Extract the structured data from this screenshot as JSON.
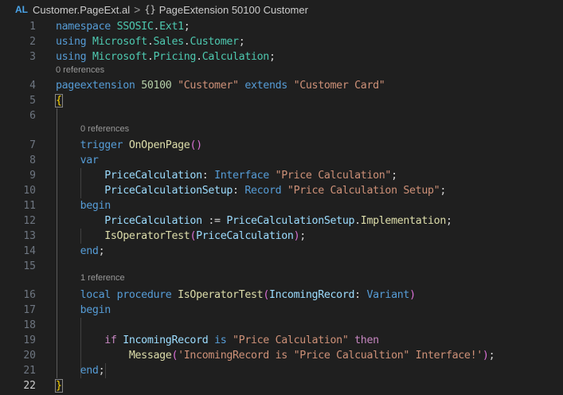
{
  "breadcrumb": {
    "lang_badge": "AL",
    "file_name": "Customer.PageExt.al",
    "separator": ">",
    "symbol_icon": "{}",
    "symbol_name": "PageExtension 50100 Customer"
  },
  "icons": {
    "lang_badge": "al-file-icon",
    "separator": "chevron-right-icon",
    "symbol": "braces-icon"
  },
  "code_lens": {
    "pageextension": "0 references",
    "trigger": "0 references",
    "procedure": "1 reference"
  },
  "lines": [
    {
      "n": "1",
      "t": [
        [
          "kw",
          "namespace"
        ],
        [
          "pl",
          " "
        ],
        [
          "ty",
          "SSOSIC"
        ],
        [
          "pl",
          "."
        ],
        [
          "ty",
          "Ext1"
        ],
        [
          "pl",
          ";"
        ]
      ]
    },
    {
      "n": "2",
      "t": [
        [
          "kw",
          "using"
        ],
        [
          "pl",
          " "
        ],
        [
          "ty",
          "Microsoft"
        ],
        [
          "pl",
          "."
        ],
        [
          "ty",
          "Sales"
        ],
        [
          "pl",
          "."
        ],
        [
          "ty",
          "Customer"
        ],
        [
          "pl",
          ";"
        ]
      ]
    },
    {
      "n": "3",
      "t": [
        [
          "kw",
          "using"
        ],
        [
          "pl",
          " "
        ],
        [
          "ty",
          "Microsoft"
        ],
        [
          "pl",
          "."
        ],
        [
          "ty",
          "Pricing"
        ],
        [
          "pl",
          "."
        ],
        [
          "ty",
          "Calculation"
        ],
        [
          "pl",
          ";"
        ]
      ]
    },
    {
      "n": "4",
      "t": [
        [
          "kw",
          "pageextension"
        ],
        [
          "pl",
          " "
        ],
        [
          "num",
          "50100"
        ],
        [
          "pl",
          " "
        ],
        [
          "str",
          "\"Customer\""
        ],
        [
          "pl",
          " "
        ],
        [
          "kw",
          "extends"
        ],
        [
          "pl",
          " "
        ],
        [
          "str",
          "\"Customer Card\""
        ]
      ]
    },
    {
      "n": "5",
      "t": [
        [
          "brkbox",
          "{"
        ]
      ]
    },
    {
      "n": "6",
      "t": []
    },
    {
      "n": "7",
      "t": [
        [
          "pl",
          "    "
        ],
        [
          "kw",
          "trigger"
        ],
        [
          "pl",
          " "
        ],
        [
          "fn",
          "OnOpenPage"
        ],
        [
          "brk2",
          "()"
        ]
      ]
    },
    {
      "n": "8",
      "t": [
        [
          "pl",
          "    "
        ],
        [
          "kw",
          "var"
        ]
      ]
    },
    {
      "n": "9",
      "t": [
        [
          "pl",
          "        "
        ],
        [
          "var",
          "PriceCalculation"
        ],
        [
          "pl",
          ": "
        ],
        [
          "kw",
          "Interface"
        ],
        [
          "pl",
          " "
        ],
        [
          "str",
          "\"Price Calculation\""
        ],
        [
          "pl",
          ";"
        ]
      ]
    },
    {
      "n": "10",
      "t": [
        [
          "pl",
          "        "
        ],
        [
          "var",
          "PriceCalculationSetup"
        ],
        [
          "pl",
          ": "
        ],
        [
          "kw",
          "Record"
        ],
        [
          "pl",
          " "
        ],
        [
          "str",
          "\"Price Calculation Setup\""
        ],
        [
          "pl",
          ";"
        ]
      ]
    },
    {
      "n": "11",
      "t": [
        [
          "pl",
          "    "
        ],
        [
          "kw",
          "begin"
        ]
      ]
    },
    {
      "n": "12",
      "t": [
        [
          "pl",
          "        "
        ],
        [
          "var",
          "PriceCalculation"
        ],
        [
          "pl",
          " := "
        ],
        [
          "var",
          "PriceCalculationSetup"
        ],
        [
          "pl",
          "."
        ],
        [
          "fn",
          "Implementation"
        ],
        [
          "pl",
          ";"
        ]
      ]
    },
    {
      "n": "13",
      "t": [
        [
          "pl",
          "        "
        ],
        [
          "fn",
          "IsOperatorTest"
        ],
        [
          "brk2",
          "("
        ],
        [
          "var",
          "PriceCalculation"
        ],
        [
          "brk2",
          ")"
        ],
        [
          "pl",
          ";"
        ]
      ]
    },
    {
      "n": "14",
      "t": [
        [
          "pl",
          "    "
        ],
        [
          "kw",
          "end"
        ],
        [
          "pl",
          ";"
        ]
      ]
    },
    {
      "n": "15",
      "t": []
    },
    {
      "n": "16",
      "t": [
        [
          "pl",
          "    "
        ],
        [
          "kw",
          "local"
        ],
        [
          "pl",
          " "
        ],
        [
          "kw",
          "procedure"
        ],
        [
          "pl",
          " "
        ],
        [
          "fn",
          "IsOperatorTest"
        ],
        [
          "brk2",
          "("
        ],
        [
          "var",
          "IncomingRecord"
        ],
        [
          "pl",
          ": "
        ],
        [
          "kw",
          "Variant"
        ],
        [
          "brk2",
          ")"
        ]
      ]
    },
    {
      "n": "17",
      "t": [
        [
          "pl",
          "    "
        ],
        [
          "kw",
          "begin"
        ]
      ]
    },
    {
      "n": "18",
      "t": []
    },
    {
      "n": "19",
      "t": [
        [
          "pl",
          "        "
        ],
        [
          "ctl",
          "if"
        ],
        [
          "pl",
          " "
        ],
        [
          "var",
          "IncomingRecord"
        ],
        [
          "pl",
          " "
        ],
        [
          "kw",
          "is"
        ],
        [
          "pl",
          " "
        ],
        [
          "str",
          "\"Price Calculation\""
        ],
        [
          "pl",
          " "
        ],
        [
          "ctl",
          "then"
        ]
      ]
    },
    {
      "n": "20",
      "t": [
        [
          "pl",
          "            "
        ],
        [
          "fn",
          "Message"
        ],
        [
          "brk2",
          "("
        ],
        [
          "str",
          "'IncomingRecord is \"Price Calcualtion\" Interface!'"
        ],
        [
          "brk2",
          ")"
        ],
        [
          "pl",
          ";"
        ]
      ]
    },
    {
      "n": "21",
      "t": [
        [
          "pl",
          "    "
        ],
        [
          "kw",
          "end"
        ],
        [
          "pl",
          ";"
        ]
      ]
    },
    {
      "n": "22",
      "t": [
        [
          "brkbox",
          "}"
        ]
      ]
    }
  ]
}
